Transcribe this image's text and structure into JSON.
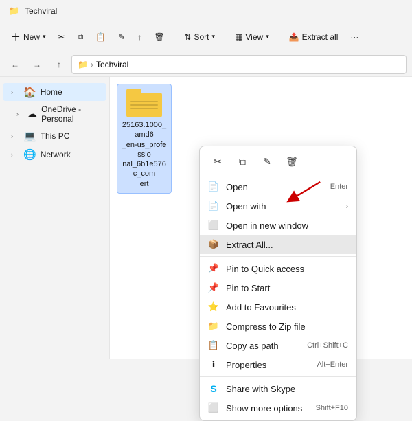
{
  "titlebar": {
    "icon": "📁",
    "title": "Techviral"
  },
  "toolbar": {
    "new_label": "New",
    "sort_label": "Sort",
    "view_label": "View",
    "extract_label": "Extract all",
    "more_label": "···"
  },
  "addressbar": {
    "back_tooltip": "Back",
    "forward_tooltip": "Forward",
    "up_tooltip": "Up",
    "path_root": "Techviral"
  },
  "sidebar": {
    "items": [
      {
        "id": "home",
        "label": "Home",
        "icon": "🏠",
        "active": true,
        "indent": 0
      },
      {
        "id": "onedrive",
        "label": "OneDrive - Personal",
        "icon": "☁",
        "active": false,
        "indent": 1
      },
      {
        "id": "thispc",
        "label": "This PC",
        "icon": "💻",
        "active": false,
        "indent": 0
      },
      {
        "id": "network",
        "label": "Network",
        "icon": "🌐",
        "active": false,
        "indent": 0
      }
    ]
  },
  "content": {
    "file": {
      "name": "25163.1000_amd6\n_en-us_professio\nal_6b1e576c_com\nert",
      "type": "zip"
    }
  },
  "context_menu": {
    "toolbar_icons": [
      "✂",
      "⧉",
      "✎",
      "🗑"
    ],
    "items": [
      {
        "id": "open",
        "icon": "📄",
        "label": "Open",
        "shortcut": "Enter",
        "arrow": false,
        "separator_after": false,
        "highlighted": false
      },
      {
        "id": "open-with",
        "icon": "📄",
        "label": "Open with",
        "shortcut": "",
        "arrow": true,
        "separator_after": false,
        "highlighted": false
      },
      {
        "id": "open-new-window",
        "icon": "⬜",
        "label": "Open in new window",
        "shortcut": "",
        "arrow": false,
        "separator_after": false,
        "highlighted": false
      },
      {
        "id": "extract-all",
        "icon": "📦",
        "label": "Extract All...",
        "shortcut": "",
        "arrow": false,
        "separator_after": false,
        "highlighted": true
      },
      {
        "id": "pin-quick",
        "icon": "📌",
        "label": "Pin to Quick access",
        "shortcut": "",
        "arrow": false,
        "separator_after": false,
        "highlighted": false
      },
      {
        "id": "pin-start",
        "icon": "📌",
        "label": "Pin to Start",
        "shortcut": "",
        "arrow": false,
        "separator_after": false,
        "highlighted": false
      },
      {
        "id": "add-favourites",
        "icon": "⭐",
        "label": "Add to Favourites",
        "shortcut": "",
        "arrow": false,
        "separator_after": false,
        "highlighted": false
      },
      {
        "id": "compress",
        "icon": "📁",
        "label": "Compress to Zip file",
        "shortcut": "",
        "arrow": false,
        "separator_after": false,
        "highlighted": false
      },
      {
        "id": "copy-path",
        "icon": "📋",
        "label": "Copy as path",
        "shortcut": "Ctrl+Shift+C",
        "arrow": false,
        "separator_after": false,
        "highlighted": false
      },
      {
        "id": "properties",
        "icon": "ℹ",
        "label": "Properties",
        "shortcut": "Alt+Enter",
        "arrow": false,
        "separator_after": true,
        "highlighted": false
      },
      {
        "id": "share-skype",
        "icon": "S",
        "label": "Share with Skype",
        "shortcut": "",
        "arrow": false,
        "separator_after": false,
        "highlighted": false,
        "skype": true
      },
      {
        "id": "more-options",
        "icon": "⬜",
        "label": "Show more options",
        "shortcut": "Shift+F10",
        "arrow": false,
        "separator_after": false,
        "highlighted": false
      }
    ]
  }
}
